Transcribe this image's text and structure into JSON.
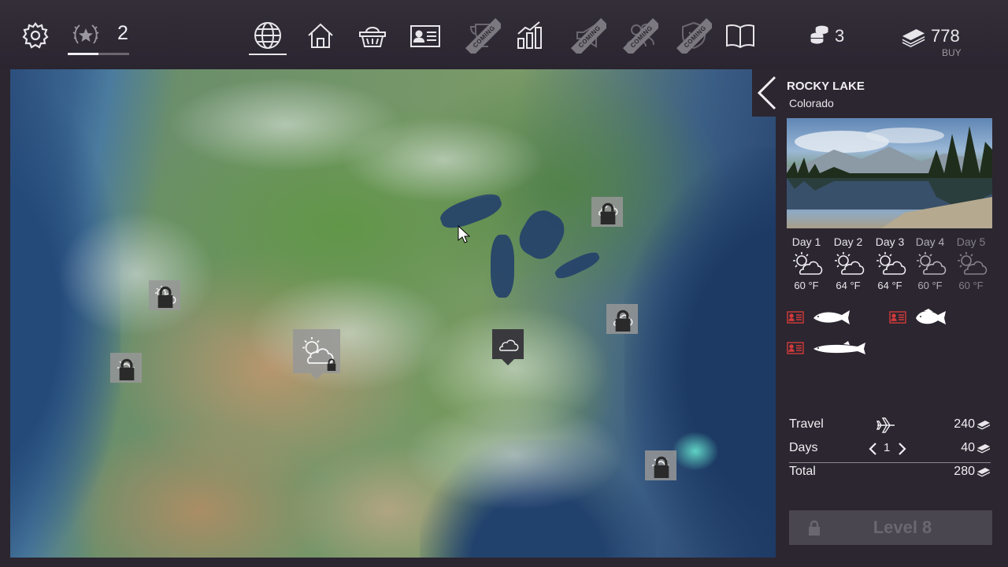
{
  "topbar": {
    "icons": [
      {
        "name": "settings",
        "icon": "gear-icon"
      },
      {
        "name": "rank",
        "icon": "laurel-star-icon"
      },
      {
        "name": "map",
        "icon": "globe-icon",
        "active": true
      },
      {
        "name": "home",
        "icon": "house-icon"
      },
      {
        "name": "shop",
        "icon": "basket-icon"
      },
      {
        "name": "license",
        "icon": "id-card-icon"
      },
      {
        "name": "tournaments",
        "icon": "trophy-icon",
        "coming_label": "COMING"
      },
      {
        "name": "stats",
        "icon": "bar-chart-icon"
      },
      {
        "name": "events",
        "icon": "megaphone-icon",
        "coming_label": "COMING"
      },
      {
        "name": "friends",
        "icon": "people-icon",
        "coming_label": "COMING"
      },
      {
        "name": "clubs",
        "icon": "shield-icon",
        "coming_label": "COMING"
      },
      {
        "name": "guide",
        "icon": "book-icon"
      }
    ],
    "rank_level": "2",
    "rank_progress": 0.5,
    "coins": "3",
    "cash": "778",
    "buy_label": "BUY"
  },
  "map": {
    "markers": [
      {
        "name": "marker-oregon",
        "weather": "partly-cloudy",
        "locked": true
      },
      {
        "name": "marker-california",
        "weather": "sunny",
        "locked": true
      },
      {
        "name": "marker-colorado",
        "weather": "partly-cloudy",
        "locked": true,
        "selected": true
      },
      {
        "name": "marker-midwest",
        "weather": "cloudy",
        "locked": false
      },
      {
        "name": "marker-northeast",
        "weather": "rain",
        "locked": true
      },
      {
        "name": "marker-eastcoast",
        "weather": "cloudy",
        "locked": true
      },
      {
        "name": "marker-florida",
        "weather": "sunny",
        "locked": true
      }
    ]
  },
  "location": {
    "name": "ROCKY LAKE",
    "region": "Colorado"
  },
  "forecast": [
    {
      "day": "Day 1",
      "temp": "60 °F",
      "weather": "partly-cloudy"
    },
    {
      "day": "Day 2",
      "temp": "64 °F",
      "weather": "partly-cloudy"
    },
    {
      "day": "Day 3",
      "temp": "64 °F",
      "weather": "partly-cloudy"
    },
    {
      "day": "Day 4",
      "temp": "60 °F",
      "weather": "partly-cloudy"
    },
    {
      "day": "Day 5",
      "temp": "60 °F",
      "weather": "partly-cloudy"
    }
  ],
  "fish": [
    {
      "icon": "fish-trout-icon",
      "license_icon": "license-icon"
    },
    {
      "icon": "fish-perch-icon",
      "license_icon": "license-icon"
    },
    {
      "icon": "fish-pike-icon",
      "license_icon": "license-icon"
    }
  ],
  "costs": {
    "travel_label": "Travel",
    "travel_value": "240",
    "days_label": "Days",
    "days_count": "1",
    "days_value": "40",
    "total_label": "Total",
    "total_value": "280"
  },
  "level_button": "Level 8",
  "colors": {
    "background": "#2b2630",
    "text": "#e8e6ea",
    "license_red": "#d23a3a",
    "locked_button": "#4a4650"
  }
}
